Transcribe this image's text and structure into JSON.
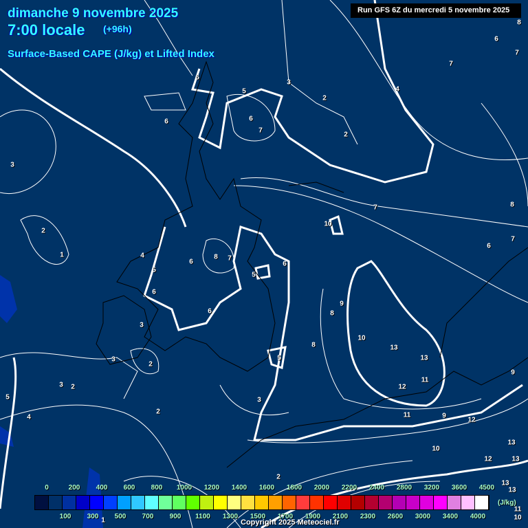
{
  "header": {
    "date": "dimanche 9 novembre 2025",
    "time": "7:00 locale",
    "lead": "(+96h)",
    "title": "Surface-Based CAPE (J/kg) et Lifted Index",
    "run": "Run GFS 6Z du mercredi 5 novembre 2025"
  },
  "map": {
    "background_color": "#003366",
    "contour_color": "#ffffff",
    "lifted_index_labels": [
      "6",
      "5",
      "3",
      "2",
      "4",
      "6",
      "6",
      "7",
      "2",
      "7",
      "6",
      "7",
      "8",
      "3",
      "7",
      "10",
      "8",
      "6",
      "7",
      "2",
      "1",
      "4",
      "6",
      "8",
      "7",
      "5",
      "5",
      "6",
      "6",
      "9",
      "8",
      "6",
      "3",
      "10",
      "13",
      "13",
      "8",
      "5",
      "3",
      "2",
      "11",
      "12",
      "9",
      "3",
      "2",
      "5",
      "3",
      "4",
      "2",
      "11",
      "9",
      "12",
      "10",
      "13",
      "12",
      "13",
      "2",
      "13",
      "13",
      "11",
      "10",
      "1"
    ]
  },
  "colorbar": {
    "unit": "(J/kg)",
    "colors": [
      "#001040",
      "#003068",
      "#0030a0",
      "#0000c8",
      "#0000ff",
      "#0040ff",
      "#00a0ff",
      "#30c8ff",
      "#60ffff",
      "#70ff9a",
      "#60ff60",
      "#60ff00",
      "#c0f010",
      "#ffff00",
      "#ffff80",
      "#ffe040",
      "#ffc800",
      "#ffa000",
      "#ff6400",
      "#ff3c3c",
      "#ff3200",
      "#ff0000",
      "#e00000",
      "#b40000",
      "#b40030",
      "#b40070",
      "#b400b4",
      "#c800c8",
      "#e000e0",
      "#ff00ff",
      "#e080e0",
      "#ffc0ff",
      "#ffffff"
    ],
    "top_labels": [
      "0",
      "200",
      "400",
      "600",
      "800",
      "1000",
      "1200",
      "1400",
      "1600",
      "1800",
      "2000",
      "2200",
      "2400",
      "2800",
      "3200",
      "3600",
      "4500"
    ],
    "bottom_labels": [
      "100",
      "300",
      "500",
      "700",
      "900",
      "1100",
      "1300",
      "1500",
      "1700",
      "1900",
      "2100",
      "2300",
      "2600",
      "3000",
      "3400",
      "4000"
    ]
  },
  "footer": {
    "copyright": "Copyright 2025 Meteociel.fr"
  }
}
